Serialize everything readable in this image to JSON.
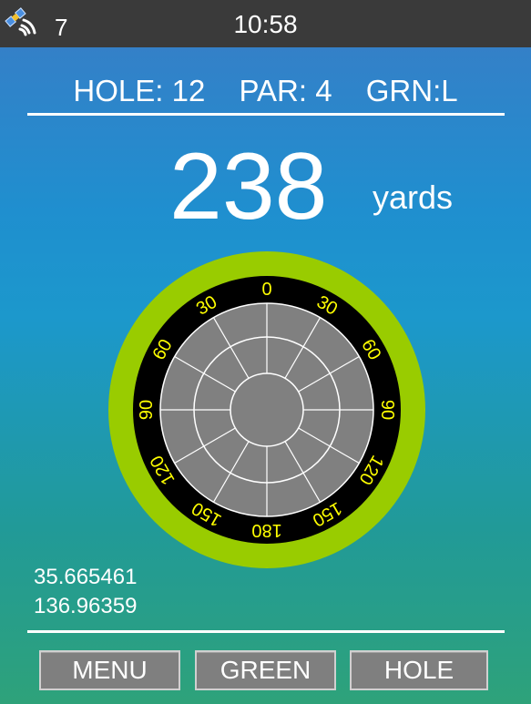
{
  "status": {
    "satellite_count": "7",
    "time": "10:58",
    "icon": "satellite-icon"
  },
  "info": {
    "hole": "HOLE: 12",
    "par": "PAR: 4",
    "green": "GRN:L"
  },
  "distance": {
    "value": "238",
    "unit": "yards"
  },
  "dial": {
    "labels": [
      "0",
      "30",
      "60",
      "90",
      "120",
      "150",
      "180",
      "150",
      "120",
      "90",
      "60",
      "30"
    ],
    "colors": {
      "outer_ring": "#99cc00",
      "bezel": "#000000",
      "face": "#808080",
      "grid": "#ffffff",
      "label": "#ffff00"
    }
  },
  "coords": {
    "latitude": "35.665461",
    "longitude": "136.96359"
  },
  "buttons": {
    "menu": "MENU",
    "green": "GREEN",
    "hole": "HOLE"
  }
}
